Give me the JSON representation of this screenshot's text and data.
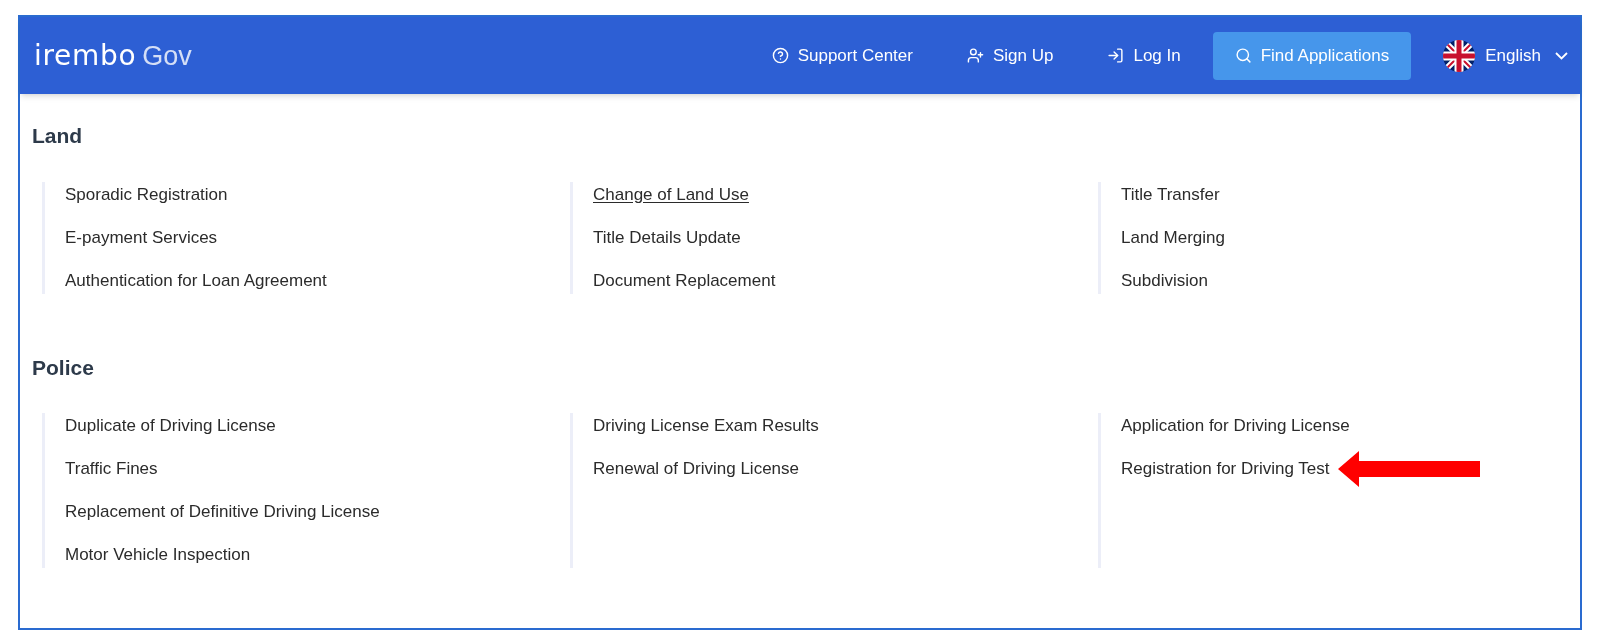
{
  "header": {
    "logo": {
      "brand": "irembo",
      "suffix": "Gov"
    },
    "nav": [
      {
        "kind": "help",
        "label": "Support Center"
      },
      {
        "kind": "signup",
        "label": "Sign Up"
      },
      {
        "kind": "login",
        "label": "Log In"
      },
      {
        "kind": "search",
        "label": "Find Applications"
      }
    ],
    "language": {
      "label": "English"
    }
  },
  "sections": [
    {
      "title": "Land",
      "columns": [
        [
          {
            "label": "Sporadic Registration",
            "hovered": false
          },
          {
            "label": "E-payment Services",
            "hovered": false
          },
          {
            "label": "Authentication for Loan Agreement",
            "hovered": false
          }
        ],
        [
          {
            "label": "Change of Land Use",
            "hovered": true
          },
          {
            "label": "Title Details Update",
            "hovered": false
          },
          {
            "label": "Document Replacement",
            "hovered": false
          }
        ],
        [
          {
            "label": "Title Transfer",
            "hovered": false
          },
          {
            "label": "Land Merging",
            "hovered": false
          },
          {
            "label": "Subdivision",
            "hovered": false
          }
        ]
      ]
    },
    {
      "title": "Police",
      "columns": [
        [
          {
            "label": "Duplicate of Driving License",
            "hovered": false
          },
          {
            "label": "Traffic Fines",
            "hovered": false
          },
          {
            "label": "Replacement of Definitive Driving License",
            "hovered": false
          },
          {
            "label": "Motor Vehicle Inspection",
            "hovered": false
          }
        ],
        [
          {
            "label": "Driving License Exam Results",
            "hovered": false
          },
          {
            "label": "Renewal of Driving License",
            "hovered": false
          }
        ],
        [
          {
            "label": "Application for Driving License",
            "hovered": false
          },
          {
            "label": "Registration for Driving Test",
            "hovered": false,
            "highlighted": true
          }
        ]
      ]
    }
  ]
}
